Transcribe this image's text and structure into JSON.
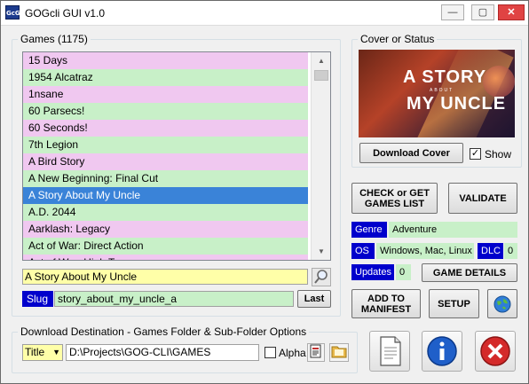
{
  "window": {
    "title": "GOGcli GUI v1.0",
    "icon_text": "GcG",
    "minimize_glyph": "—",
    "maximize_glyph": "▢",
    "close_glyph": "✕"
  },
  "games": {
    "legend": "Games  (1175)",
    "items": [
      {
        "label": "15 Days",
        "state": "pink"
      },
      {
        "label": "1954 Alcatraz",
        "state": "green"
      },
      {
        "label": "1nsane",
        "state": "pink"
      },
      {
        "label": "60 Parsecs!",
        "state": "green"
      },
      {
        "label": "60 Seconds!",
        "state": "pink"
      },
      {
        "label": "7th Legion",
        "state": "green"
      },
      {
        "label": "A Bird Story",
        "state": "pink"
      },
      {
        "label": "A New Beginning: Final Cut",
        "state": "green"
      },
      {
        "label": "A Story About My Uncle",
        "state": "selected"
      },
      {
        "label": "A.D. 2044",
        "state": "green"
      },
      {
        "label": "Aarklash: Legacy",
        "state": "pink"
      },
      {
        "label": "Act of War: Direct Action",
        "state": "green"
      },
      {
        "label": "Act of War: High Treason",
        "state": "pink"
      }
    ],
    "title_field": "A Story About My Uncle",
    "slug_label": "Slug",
    "slug_value": "story_about_my_uncle_a",
    "last_button": "Last"
  },
  "cover": {
    "legend": "Cover or Status",
    "art_line1": "A STORY",
    "art_line2": "ABOUT",
    "art_line3": "MY UNCLE",
    "download_button": "Download Cover",
    "show_label": "Show",
    "show_checked": true,
    "check_mark": "✓"
  },
  "actions": {
    "check_get_label": "CHECK or GET\nGAMES LIST",
    "validate_label": "VALIDATE",
    "genre_label": "Genre",
    "genre_value": "Adventure",
    "os_label": "OS",
    "os_value": "Windows, Mac, Linux",
    "dlc_label": "DLC",
    "dlc_value": "0",
    "updates_label": "Updates",
    "updates_value": "0",
    "game_details_label": "GAME DETAILS",
    "add_manifest_label": "ADD TO\nMANIFEST",
    "setup_label": "SETUP"
  },
  "destination": {
    "legend": "Download Destination - Games Folder & Sub-Folder Options",
    "subfolder_option": "Title",
    "path": "D:\\Projects\\GOG-CLI\\GAMES",
    "alpha_label": "Alpha",
    "alpha_checked": false
  },
  "colors": {
    "list_pink": "#f0c8f0",
    "list_green": "#c8f0c8",
    "selection_blue": "#3a83d8",
    "label_blue": "#0000cc",
    "field_yellow": "#ffffa8"
  }
}
